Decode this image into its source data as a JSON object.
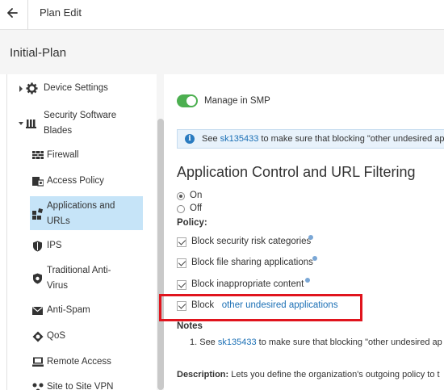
{
  "topbar": {
    "title": "Plan Edit"
  },
  "plan": {
    "name": "Initial-Plan"
  },
  "sidebar": {
    "items": [
      {
        "label": "Device Settings",
        "icon": "gear-icon"
      },
      {
        "label": "Security Software Blades",
        "label_line1": "Security Software",
        "label_line2": "Blades",
        "icon": "blades-icon"
      },
      {
        "label": "Firewall",
        "icon": "firewall-icon"
      },
      {
        "label": "Access Policy",
        "icon": "access-policy-icon"
      },
      {
        "label_line1": "Applications and",
        "label_line2": "URLs",
        "icon": "applications-icon",
        "selected": true
      },
      {
        "label": "IPS",
        "icon": "shield-icon"
      },
      {
        "label_line1": "Traditional Anti-",
        "label_line2": "Virus",
        "icon": "antivirus-shield-icon"
      },
      {
        "label": "Anti-Spam",
        "icon": "envelope-icon"
      },
      {
        "label": "QoS",
        "icon": "qos-icon"
      },
      {
        "label": "Remote Access",
        "icon": "remote-access-icon"
      },
      {
        "label": "Site to Site VPN",
        "icon": "vpn-icon"
      }
    ]
  },
  "main": {
    "manage_toggle": {
      "label": "Manage in SMP",
      "on": true
    },
    "info_bar": {
      "prefix": "See ",
      "link": "sk135433",
      "suffix": " to make sure that blocking \"other undesired ap"
    },
    "section_title": "Application Control and URL Filtering",
    "radios": [
      {
        "label": "On",
        "checked": true
      },
      {
        "label": "Off",
        "checked": false
      }
    ],
    "policy_label": "Policy:",
    "policies": [
      {
        "label": "Block security risk categories",
        "checked": true
      },
      {
        "label": "Block file sharing applications",
        "checked": true
      },
      {
        "label": "Block inappropriate content",
        "checked": true
      },
      {
        "label": "Block",
        "link": "other undesired applications",
        "checked": true
      }
    ],
    "notes": {
      "title": "Notes",
      "line_prefix": "1. See ",
      "line_link": "sk135433",
      "line_suffix": " to make sure that blocking \"other undesired ap"
    },
    "description": {
      "label": "Description:",
      "text": " Lets you define the organization's outgoing policy to t"
    }
  },
  "colors": {
    "accent": "#1a6fb5",
    "toggle_on": "#4caf50",
    "highlight": "#e0141d",
    "selected_nav": "#c6e4f8"
  }
}
